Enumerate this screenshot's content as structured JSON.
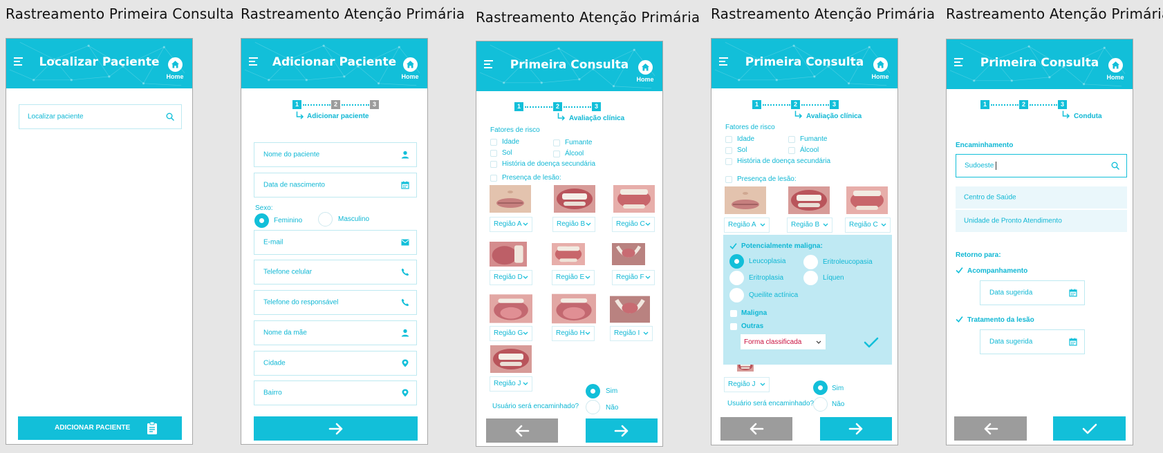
{
  "titles": [
    "Rastreamento Primeira Consulta",
    "Rastreamento Atenção Primária",
    "Rastreamento Atenção Primária",
    "Rastreamento Atenção Primária",
    "Rastreamento Atenção Primária"
  ],
  "home_label": "Home",
  "colors": {
    "primary": "#12bfd9",
    "grey": "#9c9c9c",
    "background": "#e6e6e6",
    "popup": "#bfe9f3",
    "error_text": "#c8103e"
  },
  "screen1": {
    "header": "Localizar Paciente",
    "search_placeholder": "Localizar paciente",
    "add_button": "ADICIONAR PACIENTE"
  },
  "screen2": {
    "header": "Adicionar Paciente",
    "steps": [
      "1",
      "2",
      "3"
    ],
    "subtitle": "Adicionar paciente",
    "fields": {
      "name": "Nome do paciente",
      "birth": "Data de nascimento",
      "email": "E-mail",
      "cell": "Telefone celular",
      "resp_phone": "Telefone do responsável",
      "mother": "Nome da mãe",
      "city": "Cidade",
      "district": "Bairro"
    },
    "sex_label": "Sexo:",
    "sex_options": [
      "Feminino",
      "Masculino"
    ]
  },
  "screen3": {
    "header": "Primeira Consulta",
    "steps": [
      "1",
      "2",
      "3"
    ],
    "subtitle": "Avaliação clínica",
    "risk_label": "Fatores de risco",
    "risks": [
      "Idade",
      "Fumante",
      "Sol",
      "Álcool",
      "História de doença secundária"
    ],
    "lesion_label": "Presença de lesão:",
    "regions": [
      "Região A",
      "Região B",
      "Região C",
      "Região D",
      "Região E",
      "Região F",
      "Região G",
      "Região H",
      "Região I",
      "Região J"
    ],
    "referral_q": "Usuário será encaminhado?",
    "yes": "Sim",
    "no": "Não"
  },
  "screen4": {
    "header": "Primeira Consulta",
    "steps": [
      "1",
      "2",
      "3"
    ],
    "subtitle": "Avaliação clínica",
    "risk_label": "Fatores de risco",
    "risks": [
      "Idade",
      "Fumante",
      "Sol",
      "Álcool",
      "História de doença secundária"
    ],
    "lesion_label": "Presença de lesão:",
    "regions": [
      "Região A",
      "Região B",
      "Região C",
      "Região J"
    ],
    "popup": {
      "potential": "Potencialmente maligna:",
      "options": [
        "Leucoplasia",
        "Eritroleucopasia",
        "Eritroplasia",
        "Líquen",
        "Queilite actínica"
      ],
      "malign": "Maligna",
      "others": "Outras",
      "select": "Forma classificada"
    },
    "referral_q": "Usuário será encaminhado?",
    "yes": "Sim",
    "no": "Não"
  },
  "screen5": {
    "header": "Primeira Consulta",
    "steps": [
      "1",
      "2",
      "3"
    ],
    "subtitle": "Conduta",
    "referral_label": "Encaminhamento",
    "referral_value": "Sudoeste",
    "suggestions": [
      "Centro de Saúde",
      "Unidade de Pronto Atendimento"
    ],
    "return_label": "Retorno para:",
    "follow_up": "Acompanhamento",
    "date_placeholder": "Data sugerida",
    "treatment": "Tratamento da lesão"
  }
}
